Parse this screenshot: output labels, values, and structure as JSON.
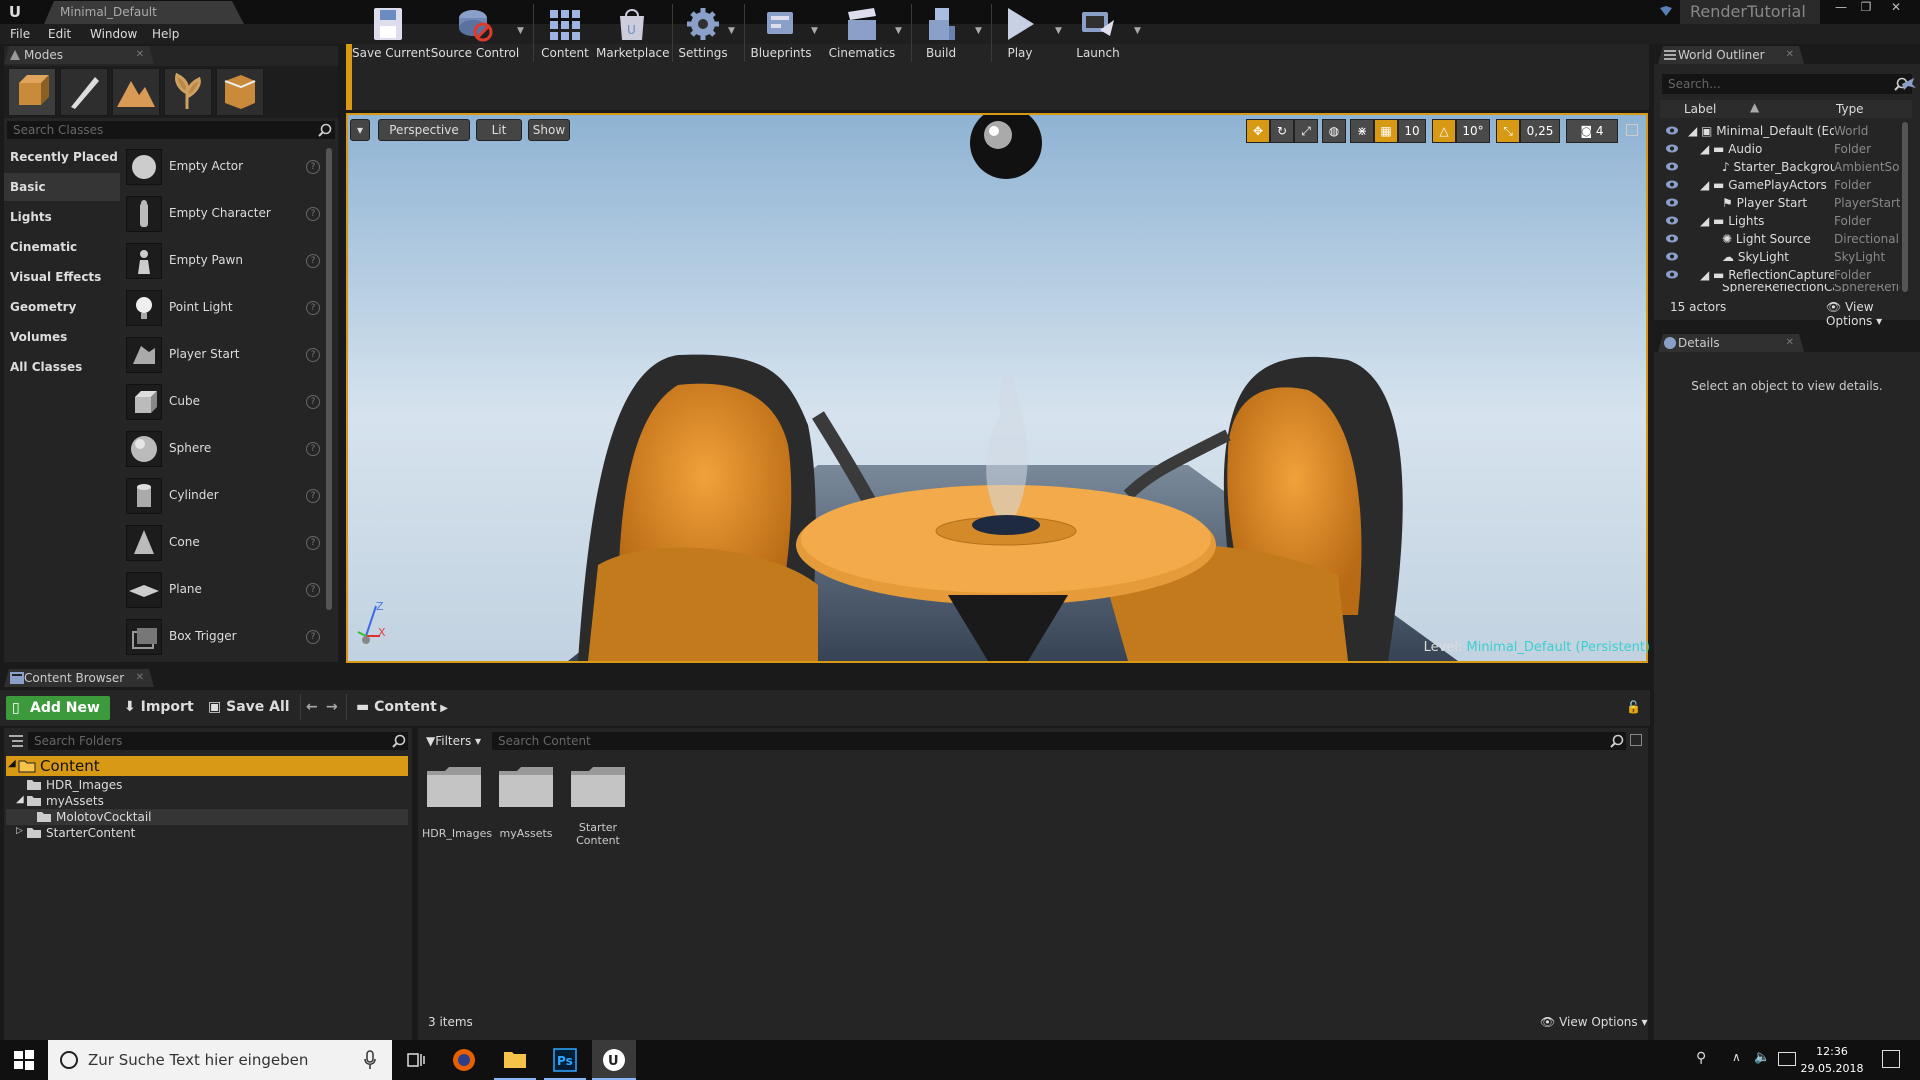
{
  "window": {
    "doc_tab": "Minimal_Default",
    "project_name": "RenderTutorial",
    "controls": [
      "—",
      "❐",
      "✕"
    ]
  },
  "menu": [
    "File",
    "Edit",
    "Window",
    "Help"
  ],
  "modes": {
    "tab_label": "Modes",
    "search_placeholder": "Search Classes",
    "categories": [
      "Recently Placed",
      "Basic",
      "Lights",
      "Cinematic",
      "Visual Effects",
      "Geometry",
      "Volumes",
      "All Classes"
    ],
    "active_category": "Basic",
    "items": [
      "Empty Actor",
      "Empty Character",
      "Empty Pawn",
      "Point Light",
      "Player Start",
      "Cube",
      "Sphere",
      "Cylinder",
      "Cone",
      "Plane",
      "Box Trigger"
    ],
    "help_glyph": "?"
  },
  "toolbar": {
    "buttons": [
      "Save Current",
      "Source Control",
      "Content",
      "Marketplace",
      "Settings",
      "Blueprints",
      "Cinematics",
      "Build",
      "Play",
      "Launch"
    ]
  },
  "viewport": {
    "perspective": "Perspective",
    "lit": "Lit",
    "show": "Show",
    "grid_snap": "10",
    "rotation_snap": "10°",
    "scale_snap": "0,25",
    "camera_speed": "4",
    "level_prefix": "Level:",
    "level_name": "Minimal_Default (Persistent)",
    "axis_z": "Z",
    "axis_x": "X"
  },
  "outliner": {
    "tab_label": "World Outliner",
    "search_placeholder": "Search...",
    "col_label": "Label",
    "col_type": "Type",
    "rows": [
      {
        "label": "Minimal_Default (Editor)",
        "type": "World"
      },
      {
        "label": "Audio",
        "type": "Folder"
      },
      {
        "label": "Starter_Background",
        "type": "AmbientSound"
      },
      {
        "label": "GamePlayActors",
        "type": "Folder"
      },
      {
        "label": "Player Start",
        "type": "PlayerStart"
      },
      {
        "label": "Lights",
        "type": "Folder"
      },
      {
        "label": "Light Source",
        "type": "DirectionalLight"
      },
      {
        "label": "SkyLight",
        "type": "SkyLight"
      },
      {
        "label": "ReflectionCaptureActors",
        "type": "Folder"
      },
      {
        "label": "SphereReflectionCapture",
        "type": "SphereReflectionCapture"
      }
    ],
    "actor_count": "15 actors",
    "view_options": "View Options"
  },
  "details": {
    "tab_label": "Details",
    "empty_text": "Select an object to view details."
  },
  "content_browser": {
    "tab_label": "Content Browser",
    "add_new": "Add New",
    "import": "Import",
    "save_all": "Save All",
    "path": "Content",
    "search_folders_placeholder": "Search Folders",
    "filters": "Filters",
    "search_content_placeholder": "Search Content",
    "folders": [
      {
        "name": "Content",
        "level": 0
      },
      {
        "name": "HDR_Images",
        "level": 1
      },
      {
        "name": "myAssets",
        "level": 1
      },
      {
        "name": "MolotovCocktail",
        "level": 2
      },
      {
        "name": "StarterContent",
        "level": 1
      }
    ],
    "assets": [
      "HDR_Images",
      "myAssets",
      "Starter Content"
    ],
    "items_count": "3 items",
    "view_options": "View Options"
  },
  "taskbar": {
    "search_text": "Zur Suche Text hier eingeben",
    "time": "12:36",
    "date": "29.05.2018"
  }
}
